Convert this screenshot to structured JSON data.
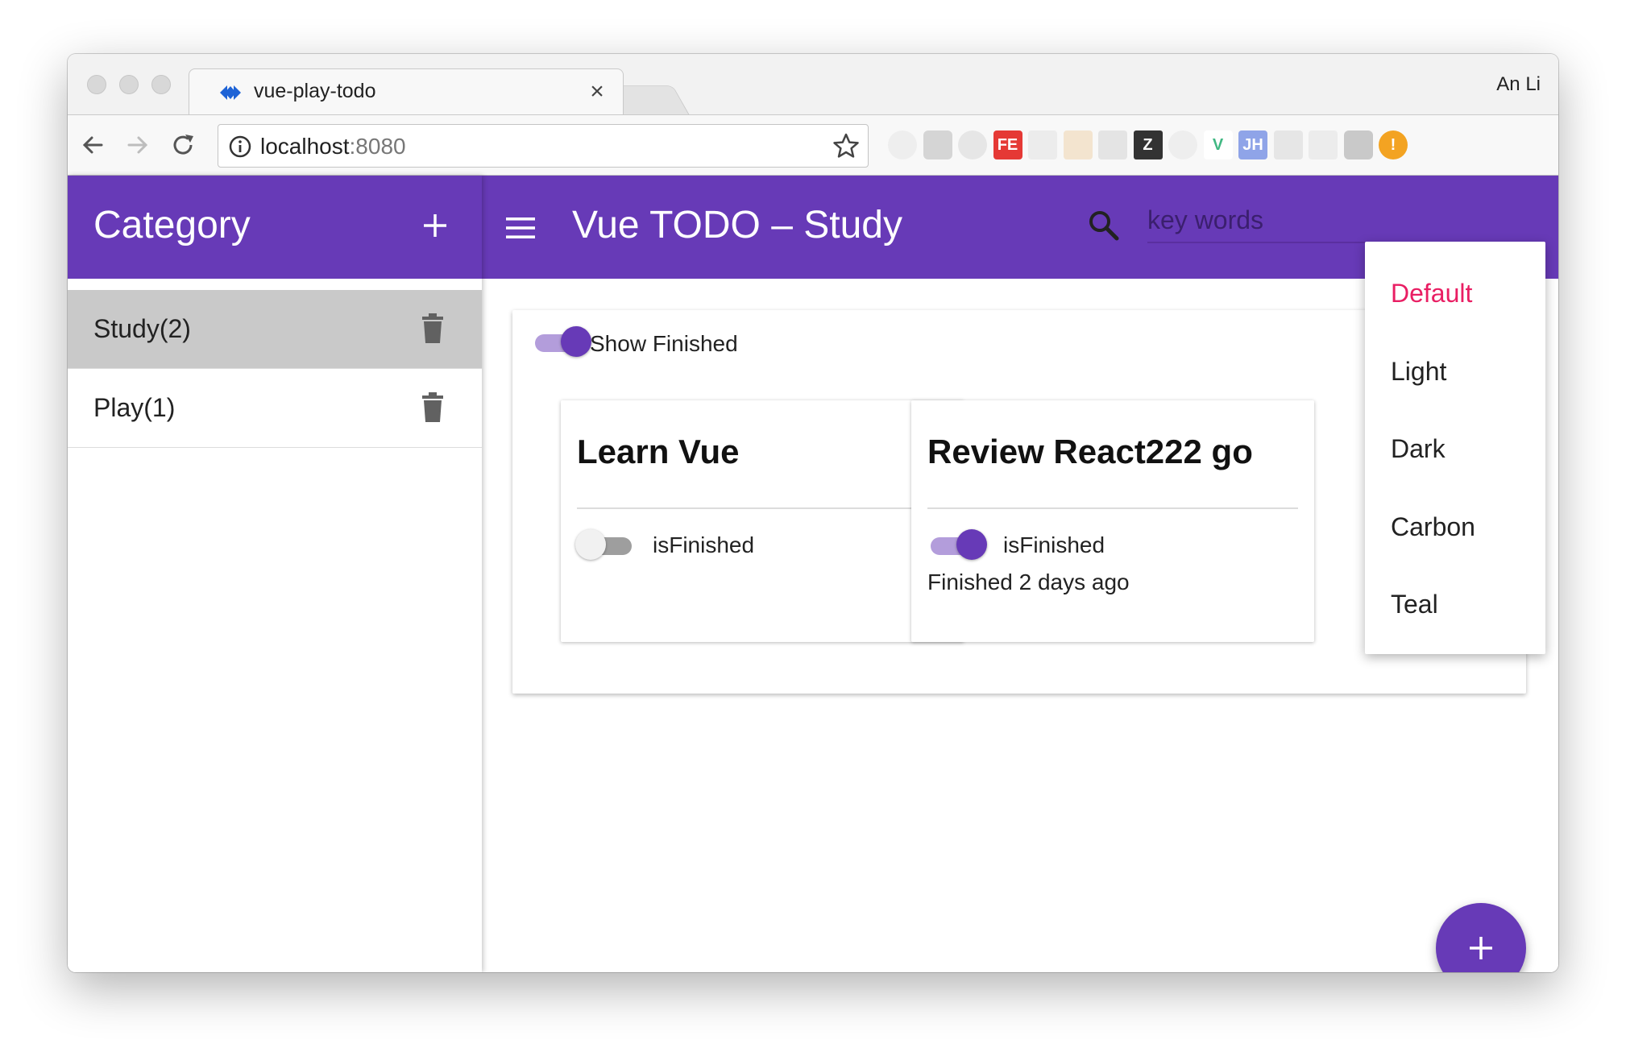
{
  "browser": {
    "tab_title": "vue-play-todo",
    "tab_close": "×",
    "profile_name": "An Li",
    "url_host": "localhost",
    "url_port": ":8080",
    "extensions": [
      {
        "name": "extension-1",
        "label": ""
      },
      {
        "name": "extension-2",
        "label": ""
      },
      {
        "name": "extension-3",
        "label": ""
      },
      {
        "name": "fe-extension",
        "label": "FE"
      },
      {
        "name": "extension-5",
        "label": ""
      },
      {
        "name": "extension-6",
        "label": ""
      },
      {
        "name": "react-devtools",
        "label": ""
      },
      {
        "name": "z-extension",
        "label": "Z"
      },
      {
        "name": "extension-9",
        "label": ""
      },
      {
        "name": "vue-devtools",
        "label": "V"
      },
      {
        "name": "jh-extension",
        "label": "JH"
      },
      {
        "name": "extension-12",
        "label": ""
      },
      {
        "name": "extension-13",
        "label": ""
      },
      {
        "name": "extension-14",
        "label": ""
      },
      {
        "name": "warning-extension",
        "label": "!"
      }
    ]
  },
  "sidebar": {
    "title": "Category",
    "categories": [
      {
        "label": "Study(2)",
        "active": true
      },
      {
        "label": "Play(1)",
        "active": false
      }
    ]
  },
  "appbar": {
    "title": "Vue TODO – Study",
    "search_placeholder": "key words"
  },
  "main": {
    "show_finished_label": "Show Finished",
    "show_finished": true,
    "todos": [
      {
        "title": "Learn Vue",
        "finished": false,
        "flag_label": "isFinished",
        "meta": ""
      },
      {
        "title": "Review React222 go",
        "finished": true,
        "flag_label": "isFinished",
        "meta": "Finished 2 days ago"
      }
    ]
  },
  "theme_menu": {
    "items": [
      "Default",
      "Light",
      "Dark",
      "Carbon",
      "Teal"
    ],
    "selected": "Default"
  },
  "colors": {
    "primary": "#673ab7",
    "primary_light": "#b39ddb",
    "accent": "#e91e63",
    "active_item": "#c9c9c9"
  }
}
